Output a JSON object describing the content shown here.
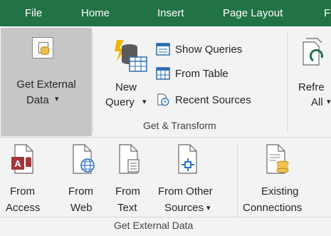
{
  "menu": {
    "tabs": [
      "File",
      "Home",
      "Insert",
      "Page Layout",
      "F"
    ]
  },
  "ribbon": {
    "get_external_data": {
      "line1": "Get External",
      "line2": "Data",
      "arrow": "▾"
    },
    "new_query": {
      "line1": "New",
      "line2": "Query",
      "arrow": "▾"
    },
    "show_queries": "Show Queries",
    "from_table": "From Table",
    "recent_sources": "Recent Sources",
    "group_get_transform": "Get & Transform",
    "refresh_all": {
      "line1": "Refre",
      "line2": "All",
      "arrow": "▾"
    }
  },
  "lower": {
    "from_access": {
      "line1": "From",
      "line2": "Access"
    },
    "from_web": {
      "line1": "From",
      "line2": "Web"
    },
    "from_text": {
      "line1": "From",
      "line2": "Text"
    },
    "from_other": {
      "line1": "From Other",
      "line2": "Sources",
      "arrow": "▾"
    },
    "existing": {
      "line1": "Existing",
      "line2": "Connections"
    },
    "group_label": "Get External Data"
  },
  "colors": {
    "menubar": "#217346",
    "ribbon_bg": "#f3f3f3",
    "selected_button": "#c6c6c6",
    "access_red": "#a4373a",
    "web_blue": "#2b78c5"
  },
  "icons": [
    "database-icon",
    "new-query-icon",
    "show-queries-icon",
    "from-table-icon",
    "recent-sources-icon",
    "refresh-icon",
    "access-icon",
    "web-globe-icon",
    "text-doc-icon",
    "other-sources-icon",
    "existing-connections-icon"
  ]
}
